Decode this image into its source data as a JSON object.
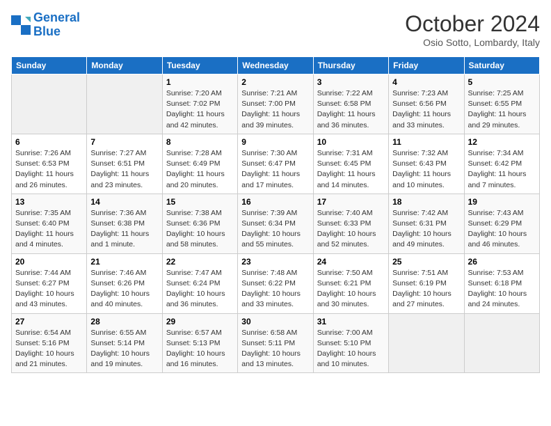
{
  "header": {
    "logo_line1": "General",
    "logo_line2": "Blue",
    "month": "October 2024",
    "location": "Osio Sotto, Lombardy, Italy"
  },
  "columns": [
    "Sunday",
    "Monday",
    "Tuesday",
    "Wednesday",
    "Thursday",
    "Friday",
    "Saturday"
  ],
  "weeks": [
    [
      {
        "day": "",
        "detail": ""
      },
      {
        "day": "",
        "detail": ""
      },
      {
        "day": "1",
        "detail": "Sunrise: 7:20 AM\nSunset: 7:02 PM\nDaylight: 11 hours and 42 minutes."
      },
      {
        "day": "2",
        "detail": "Sunrise: 7:21 AM\nSunset: 7:00 PM\nDaylight: 11 hours and 39 minutes."
      },
      {
        "day": "3",
        "detail": "Sunrise: 7:22 AM\nSunset: 6:58 PM\nDaylight: 11 hours and 36 minutes."
      },
      {
        "day": "4",
        "detail": "Sunrise: 7:23 AM\nSunset: 6:56 PM\nDaylight: 11 hours and 33 minutes."
      },
      {
        "day": "5",
        "detail": "Sunrise: 7:25 AM\nSunset: 6:55 PM\nDaylight: 11 hours and 29 minutes."
      }
    ],
    [
      {
        "day": "6",
        "detail": "Sunrise: 7:26 AM\nSunset: 6:53 PM\nDaylight: 11 hours and 26 minutes."
      },
      {
        "day": "7",
        "detail": "Sunrise: 7:27 AM\nSunset: 6:51 PM\nDaylight: 11 hours and 23 minutes."
      },
      {
        "day": "8",
        "detail": "Sunrise: 7:28 AM\nSunset: 6:49 PM\nDaylight: 11 hours and 20 minutes."
      },
      {
        "day": "9",
        "detail": "Sunrise: 7:30 AM\nSunset: 6:47 PM\nDaylight: 11 hours and 17 minutes."
      },
      {
        "day": "10",
        "detail": "Sunrise: 7:31 AM\nSunset: 6:45 PM\nDaylight: 11 hours and 14 minutes."
      },
      {
        "day": "11",
        "detail": "Sunrise: 7:32 AM\nSunset: 6:43 PM\nDaylight: 11 hours and 10 minutes."
      },
      {
        "day": "12",
        "detail": "Sunrise: 7:34 AM\nSunset: 6:42 PM\nDaylight: 11 hours and 7 minutes."
      }
    ],
    [
      {
        "day": "13",
        "detail": "Sunrise: 7:35 AM\nSunset: 6:40 PM\nDaylight: 11 hours and 4 minutes."
      },
      {
        "day": "14",
        "detail": "Sunrise: 7:36 AM\nSunset: 6:38 PM\nDaylight: 11 hours and 1 minute."
      },
      {
        "day": "15",
        "detail": "Sunrise: 7:38 AM\nSunset: 6:36 PM\nDaylight: 10 hours and 58 minutes."
      },
      {
        "day": "16",
        "detail": "Sunrise: 7:39 AM\nSunset: 6:34 PM\nDaylight: 10 hours and 55 minutes."
      },
      {
        "day": "17",
        "detail": "Sunrise: 7:40 AM\nSunset: 6:33 PM\nDaylight: 10 hours and 52 minutes."
      },
      {
        "day": "18",
        "detail": "Sunrise: 7:42 AM\nSunset: 6:31 PM\nDaylight: 10 hours and 49 minutes."
      },
      {
        "day": "19",
        "detail": "Sunrise: 7:43 AM\nSunset: 6:29 PM\nDaylight: 10 hours and 46 minutes."
      }
    ],
    [
      {
        "day": "20",
        "detail": "Sunrise: 7:44 AM\nSunset: 6:27 PM\nDaylight: 10 hours and 43 minutes."
      },
      {
        "day": "21",
        "detail": "Sunrise: 7:46 AM\nSunset: 6:26 PM\nDaylight: 10 hours and 40 minutes."
      },
      {
        "day": "22",
        "detail": "Sunrise: 7:47 AM\nSunset: 6:24 PM\nDaylight: 10 hours and 36 minutes."
      },
      {
        "day": "23",
        "detail": "Sunrise: 7:48 AM\nSunset: 6:22 PM\nDaylight: 10 hours and 33 minutes."
      },
      {
        "day": "24",
        "detail": "Sunrise: 7:50 AM\nSunset: 6:21 PM\nDaylight: 10 hours and 30 minutes."
      },
      {
        "day": "25",
        "detail": "Sunrise: 7:51 AM\nSunset: 6:19 PM\nDaylight: 10 hours and 27 minutes."
      },
      {
        "day": "26",
        "detail": "Sunrise: 7:53 AM\nSunset: 6:18 PM\nDaylight: 10 hours and 24 minutes."
      }
    ],
    [
      {
        "day": "27",
        "detail": "Sunrise: 6:54 AM\nSunset: 5:16 PM\nDaylight: 10 hours and 21 minutes."
      },
      {
        "day": "28",
        "detail": "Sunrise: 6:55 AM\nSunset: 5:14 PM\nDaylight: 10 hours and 19 minutes."
      },
      {
        "day": "29",
        "detail": "Sunrise: 6:57 AM\nSunset: 5:13 PM\nDaylight: 10 hours and 16 minutes."
      },
      {
        "day": "30",
        "detail": "Sunrise: 6:58 AM\nSunset: 5:11 PM\nDaylight: 10 hours and 13 minutes."
      },
      {
        "day": "31",
        "detail": "Sunrise: 7:00 AM\nSunset: 5:10 PM\nDaylight: 10 hours and 10 minutes."
      },
      {
        "day": "",
        "detail": ""
      },
      {
        "day": "",
        "detail": ""
      }
    ]
  ]
}
